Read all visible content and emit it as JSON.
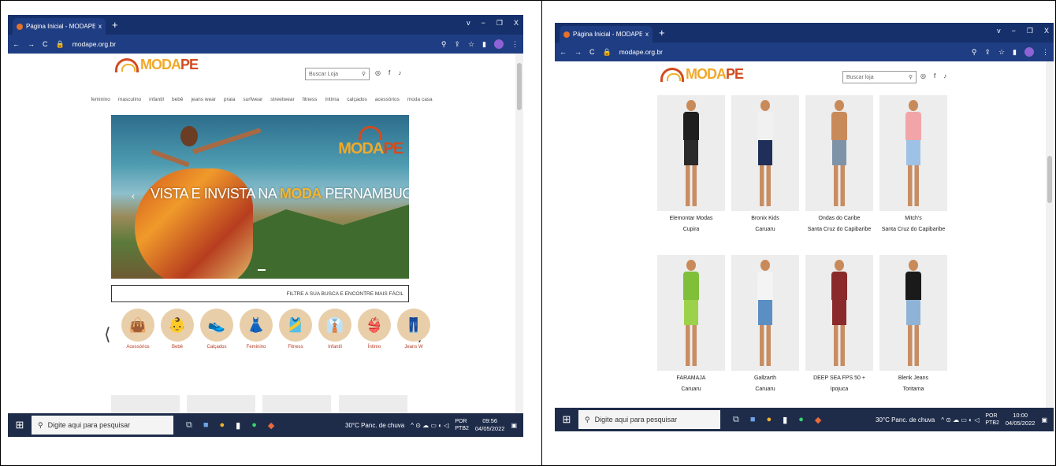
{
  "left": {
    "browser": {
      "tab_title": "Página Inicial - MODAPE",
      "tab_close": "x",
      "new_tab": "+",
      "window_controls": [
        "v",
        "−",
        "❐",
        "X"
      ],
      "url": "modape.org.br"
    },
    "site": {
      "logo_text_a": "MODA",
      "logo_text_b": "PE",
      "search_placeholder": "Buscar Loja",
      "menu": [
        "feminino",
        "masculino",
        "infantil",
        "bebê",
        "jeans wear",
        "praia",
        "surfwear",
        "streetwear",
        "fitness",
        "íntima",
        "calçados",
        "acessórios",
        "moda casa"
      ],
      "hero_slogan_a": "VISTA E INVISTA NA ",
      "hero_slogan_b": "MODA",
      "hero_slogan_c": " PERNAMBUCANA.",
      "filter_text": "FILTRE A SUA BUSCA E ENCONTRE MAIS FÁCIL",
      "categories": [
        "Acessórios",
        "Bebê",
        "Calçados",
        "Feminino",
        "Fitness",
        "Infantil",
        "Íntimo",
        "Jeans W"
      ],
      "cat_icons": [
        "handbag-icon",
        "onesie-icon",
        "sneaker-icon",
        "dress-icon",
        "sports-bra-icon",
        "shirt-icon",
        "bra-icon",
        "jeans-icon"
      ]
    },
    "taskbar": {
      "search_placeholder": "Digite aqui para pesquisar",
      "weather": "30°C  Panc. de chuva",
      "lang_a": "POR",
      "lang_b": "PTB2",
      "time": "09:56",
      "date": "04/05/2022"
    }
  },
  "right": {
    "browser": {
      "tab_title": "Página Inicial - MODAPE",
      "tab_close": "x",
      "new_tab": "+",
      "url": "modape.org.br"
    },
    "site": {
      "search_placeholder": "Buscar loja",
      "stores": [
        {
          "name": "Elemontar Modas",
          "city": "Cupira",
          "top": "#1f1f1f",
          "bottom": "#2a2a2a"
        },
        {
          "name": "Bronix Kids",
          "city": "Caruaru",
          "top": "#f1f1f1",
          "bottom": "#1f2f5a"
        },
        {
          "name": "Ondas do Caribe",
          "city": "Santa Cruz do Capibaribe",
          "top": "#c98a5a",
          "bottom": "#7f93a8"
        },
        {
          "name": "Mitch's",
          "city": "Santa Cruz do Capibaribe",
          "top": "#f2a5a8",
          "bottom": "#9ec2e6"
        },
        {
          "name": "FARAMAJA",
          "city": "Caruaru",
          "top": "#7fbf3a",
          "bottom": "#9cd14a"
        },
        {
          "name": "Gallzarth",
          "city": "Caruaru",
          "top": "#f4f4f4",
          "bottom": "#5b8fc4"
        },
        {
          "name": "DEEP SEA FPS 50 +",
          "city": "Ipojuca",
          "top": "#8a2a2a",
          "bottom": "#8a2a2a"
        },
        {
          "name": "Blenk Jeans",
          "city": "Toritama",
          "top": "#1a1a1a",
          "bottom": "#8fb3d6"
        }
      ]
    },
    "taskbar": {
      "search_placeholder": "Digite aqui para pesquisar",
      "weather": "30°C  Panc. de chuva",
      "lang_a": "POR",
      "lang_b": "PTB2",
      "time": "10:00",
      "date": "04/05/2022"
    }
  }
}
